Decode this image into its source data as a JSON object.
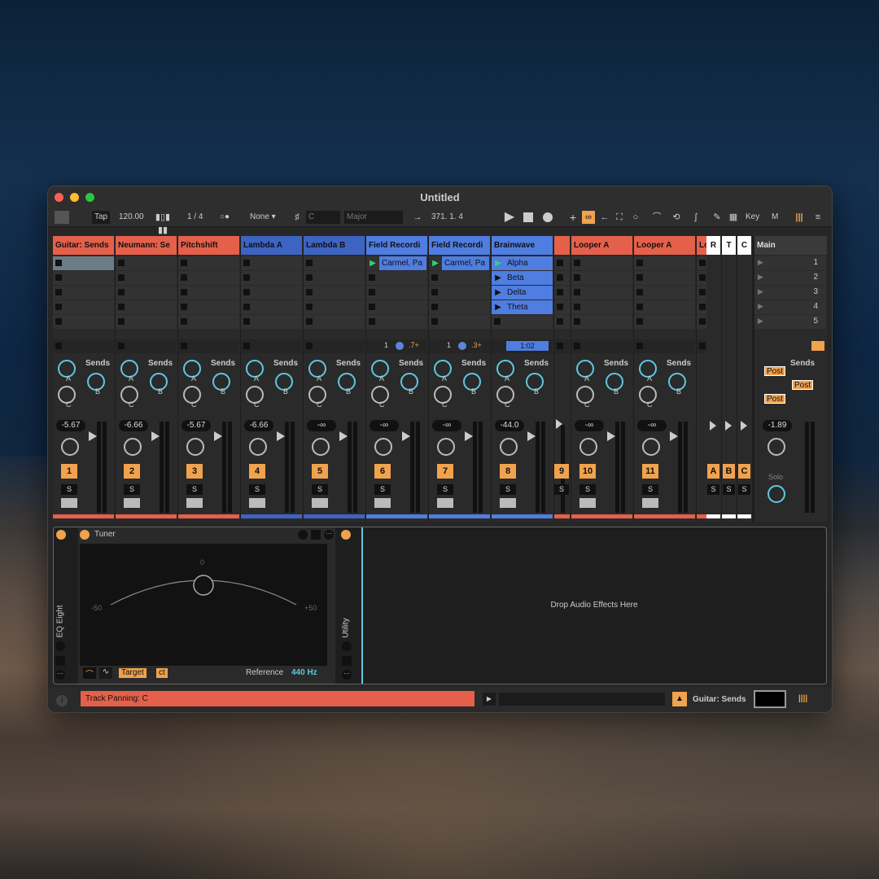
{
  "window": {
    "title": "Untitled"
  },
  "control_bar": {
    "tap": "Tap",
    "tempo": "120.00",
    "time_sig": "1 / 4",
    "metro": "○●",
    "quantize": "None",
    "key_root": "C",
    "scale": "Major",
    "position": "371.  1.  4",
    "key_btn": "Key",
    "midi_btn": "M"
  },
  "tracks": [
    {
      "name": "Guitar: Sends",
      "color": "#e5604a",
      "num": "1",
      "vol": "-5.67"
    },
    {
      "name": "Neumann: Se",
      "color": "#e5604a",
      "num": "2",
      "vol": "-6.66"
    },
    {
      "name": "Pitchshift",
      "color": "#e5604a",
      "num": "3",
      "vol": "-5.67"
    },
    {
      "name": "Lambda A",
      "color": "#3d64c2",
      "num": "4",
      "vol": "-6.66"
    },
    {
      "name": "Lambda B",
      "color": "#3d64c2",
      "num": "5",
      "vol": "-∞"
    },
    {
      "name": "Field Recordi",
      "color": "#4f7de0",
      "num": "6",
      "vol": "-∞",
      "clip": "Carmel, Pa",
      "stop": "1",
      "loop": ".7+"
    },
    {
      "name": "Field Recordi",
      "color": "#4f7de0",
      "num": "7",
      "vol": "-∞",
      "clip": "Carmel, Pa",
      "stop": "1",
      "loop": ".3+"
    },
    {
      "name": "Brainwave",
      "color": "#4f7de0",
      "num": "8",
      "vol": "-44.0",
      "clips": [
        "Alpha",
        "Beta",
        "Delta",
        "Theta"
      ],
      "time": "1:02"
    },
    {
      "name": "",
      "color": "#e5604a",
      "num": "9",
      "vol": ""
    },
    {
      "name": "Looper A",
      "color": "#e5604a",
      "num": "10",
      "vol": "-∞"
    },
    {
      "name": "Looper A",
      "color": "#e5604a",
      "num": "11",
      "vol": "-∞"
    },
    {
      "name": "Lo",
      "color": "#e5604a",
      "num": "",
      "vol": ""
    }
  ],
  "sends_label": "Sends",
  "knob_labels": {
    "a": "A",
    "b": "B",
    "c": "C"
  },
  "solo_label": "S",
  "returns": [
    {
      "name": "R",
      "letter": "A"
    },
    {
      "name": "T",
      "letter": "B"
    },
    {
      "name": "C",
      "letter": "C"
    }
  ],
  "main": {
    "name": "Main",
    "scenes": [
      "1",
      "2",
      "3",
      "4",
      "5"
    ],
    "post": [
      "Post",
      "Post",
      "Post"
    ],
    "vol": "-1.89",
    "solo": "Solo"
  },
  "devices": {
    "eq": "EQ Eight",
    "tuner": {
      "title": "Tuner",
      "zero": "0",
      "minus": "-50",
      "plus": "+50",
      "target": "Target",
      "unit": "ct",
      "reference_label": "Reference",
      "reference_value": "440 Hz"
    },
    "utility": "Utility",
    "drop_text": "Drop Audio Effects Here"
  },
  "status": {
    "info": "Track Panning: C",
    "track": "Guitar: Sends"
  },
  "colors": {
    "orange": "#e5604a",
    "blue": "#3d64c2",
    "accent": "#f0a24d",
    "cyan": "#5ec8e0"
  }
}
